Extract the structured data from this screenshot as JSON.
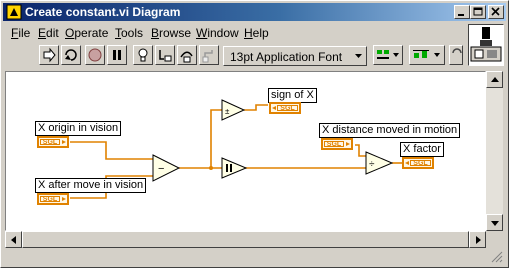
{
  "window": {
    "title": "Create constant.vi Diagram"
  },
  "menubar": {
    "items": [
      "File",
      "Edit",
      "Operate",
      "Tools",
      "Browse",
      "Window",
      "Help"
    ],
    "mnemonics": [
      "F",
      "E",
      "O",
      "T",
      "B",
      "W",
      "H"
    ]
  },
  "toolbar": {
    "font": "13pt Application Font"
  },
  "diagram": {
    "controls": [
      {
        "label": "X origin in vision",
        "type": "SGL"
      },
      {
        "label": "X after move in vision",
        "type": "SGL"
      },
      {
        "label": "X distance moved in motion",
        "type": "SGL"
      }
    ],
    "indicators": [
      {
        "label": "sign of X",
        "type": "SGL"
      },
      {
        "label": "X factor",
        "type": "SGL"
      }
    ],
    "functions": [
      {
        "name": "subtract",
        "symbol": "−"
      },
      {
        "name": "sign",
        "symbol": "±"
      },
      {
        "name": "absolute value",
        "symbol": "|·|"
      },
      {
        "name": "divide",
        "symbol": "÷"
      }
    ],
    "wire_color": "#e08200"
  },
  "colors": {
    "title_bar": "#0a246a",
    "float_wire": "#e08200",
    "chrome": "#d4d0c8"
  }
}
